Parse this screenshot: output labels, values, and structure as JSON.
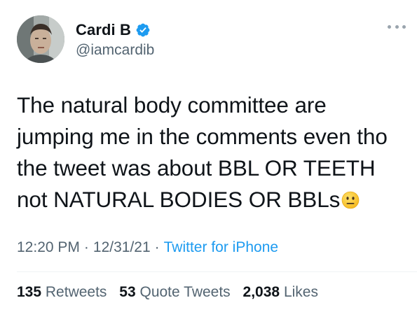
{
  "author": {
    "display_name": "Cardi B",
    "handle": "@iamcardib",
    "verified": true,
    "icons": {
      "avatar": "profile-photo",
      "verified": "verified-badge-icon",
      "more": "more-options-icon"
    }
  },
  "tweet": {
    "lines": [
      "The natural body committee are",
      "jumping me in the comments even tho",
      "the tweet was about BBL OR TEETH",
      "not NATURAL BODIES OR BBLs"
    ],
    "emoji": "neutral-face-emoji"
  },
  "meta": {
    "time": "12:20 PM",
    "separator": "·",
    "date": "12/31/21",
    "source": "Twitter for iPhone"
  },
  "stats": {
    "retweets_count": "135",
    "retweets_label": "Retweets",
    "quotes_count": "53",
    "quotes_label": "Quote Tweets",
    "likes_count": "2,038",
    "likes_label": "Likes"
  },
  "colors": {
    "text": "#0f1419",
    "secondary": "#536471",
    "link": "#1d9bf0",
    "verified": "#1d9bf0"
  }
}
